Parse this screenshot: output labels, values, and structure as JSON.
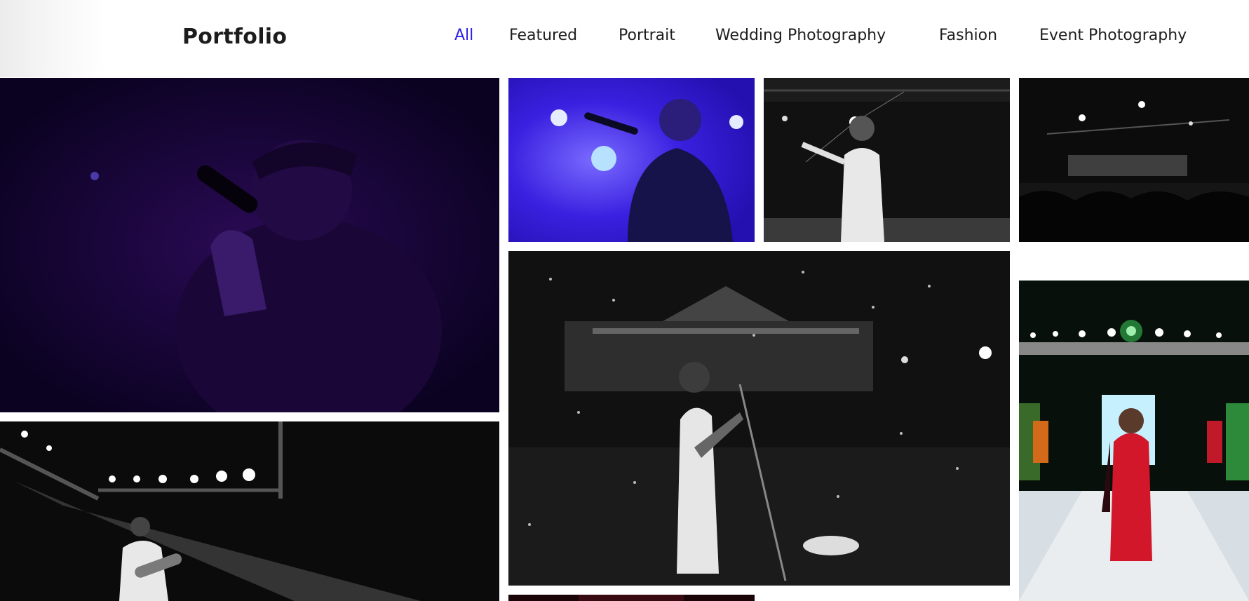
{
  "header": {
    "logo": "Portfolio"
  },
  "nav": [
    {
      "key": "all",
      "label": "All",
      "active": true
    },
    {
      "key": "featured",
      "label": "Featured",
      "active": false
    },
    {
      "key": "portrait",
      "label": "Portrait",
      "active": false
    },
    {
      "key": "wedding",
      "label": "Wedding Photography",
      "active": false
    },
    {
      "key": "fashion",
      "label": "Fashion",
      "active": false
    },
    {
      "key": "event",
      "label": "Event Photography",
      "active": false
    }
  ],
  "colors": {
    "accent": "#2b1ee6",
    "text": "#1e1e1e"
  },
  "gallery": [
    {
      "key": "singer-purple-closeup",
      "subject": "singer with microphone, purple light"
    },
    {
      "key": "singer-blue-stage",
      "subject": "singer on stage, blue lights"
    },
    {
      "key": "performer-white-tshirt-bw",
      "subject": "performer in white t-shirt, black and white"
    },
    {
      "key": "crowd-lights-bw",
      "subject": "stage lights over crowd, black and white"
    },
    {
      "key": "guitarist-confetti-bw",
      "subject": "guitarist singing with confetti, black and white"
    },
    {
      "key": "guitarist-spotlight-bw",
      "subject": "guitarist under spotlights, black and white"
    },
    {
      "key": "runway-red-saree",
      "subject": "model in red saree on runway"
    },
    {
      "key": "partial-bottom-tile",
      "subject": "dark red photo (cropped)"
    }
  ]
}
